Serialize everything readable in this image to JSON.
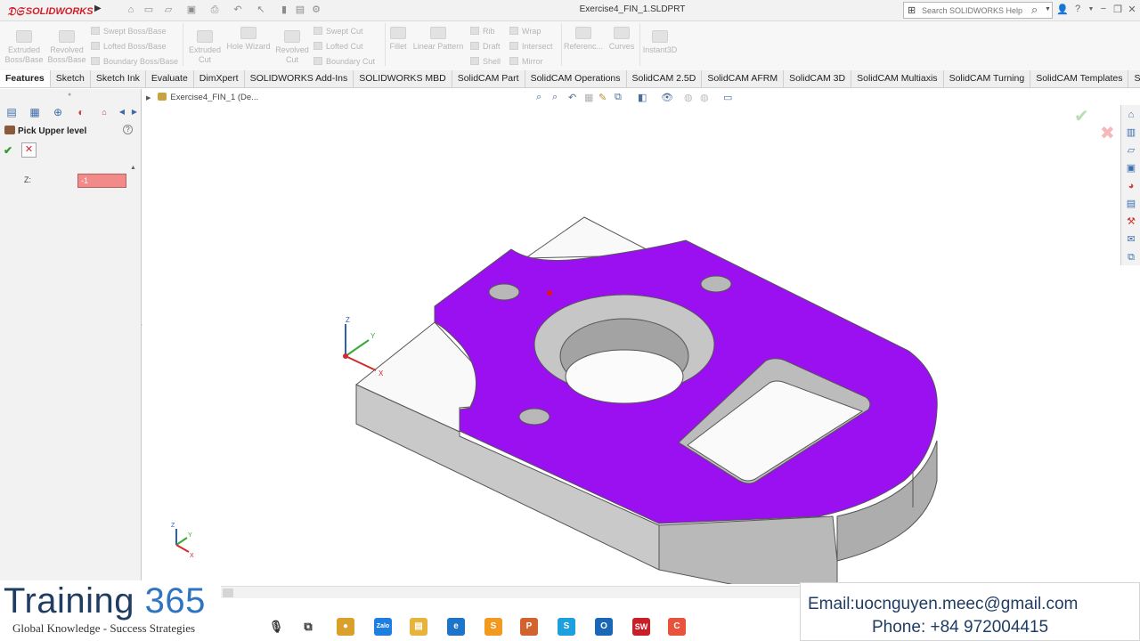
{
  "window": {
    "app_name": "SOLIDWORKS",
    "document_title": "Exercise4_FIN_1.SLDPRT",
    "search_placeholder": "Search SOLIDWORKS Help"
  },
  "command_manager": {
    "features": [
      {
        "label1": "Extruded",
        "label2": "Boss/Base"
      },
      {
        "label1": "Revolved",
        "label2": "Boss/Base"
      },
      {
        "label1": "Extruded",
        "label2": "Cut"
      },
      {
        "label1": "Hole Wizard",
        "label2": ""
      },
      {
        "label1": "Revolved",
        "label2": "Cut"
      },
      {
        "label1": "Fillet",
        "label2": ""
      },
      {
        "label1": "Linear Pattern",
        "label2": ""
      },
      {
        "label1": "Referenc...",
        "label2": ""
      },
      {
        "label1": "Curves",
        "label2": ""
      },
      {
        "label1": "Instant3D",
        "label2": ""
      }
    ],
    "small": [
      "Swept Boss/Base",
      "Lofted Boss/Base",
      "Boundary Boss/Base",
      "Swept Cut",
      "Lofted Cut",
      "Boundary Cut",
      "Rib",
      "Draft",
      "Shell",
      "Wrap",
      "Intersect",
      "Mirror"
    ]
  },
  "tabs": [
    "Features",
    "Sketch",
    "Sketch Ink",
    "Evaluate",
    "DimXpert",
    "SOLIDWORKS Add-Ins",
    "SOLIDWORKS MBD",
    "SolidCAM Part",
    "SolidCAM Operations",
    "SolidCAM 2.5D",
    "SolidCAM AFRM",
    "SolidCAM 3D",
    "SolidCAM Multiaxis",
    "SolidCAM Turning",
    "SolidCAM Templates",
    "SOLIDWORKS I..."
  ],
  "active_tab": "Features",
  "property_manager": {
    "title": "Pick Upper level",
    "help": "?",
    "ok_symbol": "✔",
    "cancel_symbol": "✕",
    "z_label": "Z:",
    "z_value": "-1"
  },
  "viewport": {
    "breadcrumb": "Exercise4_FIN_1  (De...",
    "triad_labels": {
      "z": "Z",
      "y": "Y",
      "x": "X"
    },
    "confirm_ok": "✔",
    "confirm_cancel": "✖"
  },
  "brand": {
    "name_prefix": "Training ",
    "name_number": "365",
    "tagline": "Global Knowledge - Success Strategies"
  },
  "contact": {
    "email": "Email:uocnguyen.meec@gmail.com",
    "phone": "Phone: +84 972004415"
  },
  "taskbar_apps": [
    {
      "name": "microphone-icon",
      "glyph": "🎙",
      "color": "#ffffff"
    },
    {
      "name": "task-view-icon",
      "glyph": "⧉",
      "color": "#ffffff"
    },
    {
      "name": "chrome-icon",
      "glyph": "●",
      "color": "#d9a12c"
    },
    {
      "name": "zalo-icon",
      "glyph": "Zalo",
      "color": "#1f7fe0"
    },
    {
      "name": "file-explorer-icon",
      "glyph": "▤",
      "color": "#e6b43c"
    },
    {
      "name": "edge-icon",
      "glyph": "e",
      "color": "#1e74c8"
    },
    {
      "name": "sublime-icon",
      "glyph": "S",
      "color": "#f29a1f"
    },
    {
      "name": "powerpoint-icon",
      "glyph": "P",
      "color": "#d2632f"
    },
    {
      "name": "skype-icon",
      "glyph": "S",
      "color": "#1ea0de"
    },
    {
      "name": "outlook-icon",
      "glyph": "O",
      "color": "#1a68b5"
    },
    {
      "name": "solidworks-icon",
      "glyph": "SW",
      "color": "#c8202a"
    },
    {
      "name": "camtasia-icon",
      "glyph": "C",
      "color": "#e8533c"
    }
  ],
  "colors": {
    "accent_purple": "#9b10f0",
    "brand_navy": "#1f3d62",
    "brand_blue": "#2f74c0",
    "sw_red": "#d0202a"
  }
}
